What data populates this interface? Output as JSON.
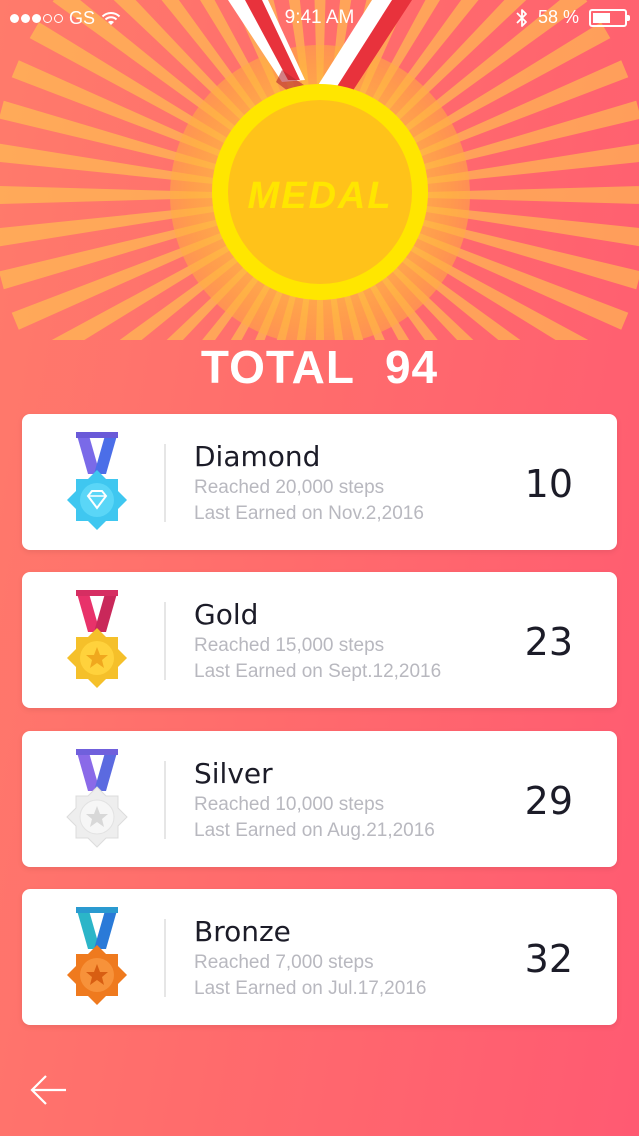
{
  "status_bar": {
    "carrier": "GS",
    "time": "9:41 AM",
    "battery_text": "58 %",
    "battery_level": 0.58,
    "signal_bars": 3,
    "icons": [
      "wifi-icon",
      "bluetooth-icon",
      "battery-icon"
    ]
  },
  "hero": {
    "medal_text": "MEDAL",
    "total_label": "TOTAL",
    "total_value": "94"
  },
  "medals": [
    {
      "name": "Diamond",
      "steps": "Reached 20,000 steps",
      "last": "Last Earned on Nov.2,2016",
      "count": "10",
      "icon": "diamond-medal-icon"
    },
    {
      "name": "Gold",
      "steps": "Reached 15,000 steps",
      "last": "Last Earned on Sept.12,2016",
      "count": "23",
      "icon": "gold-star-medal-icon"
    },
    {
      "name": "Silver",
      "steps": "Reached 10,000 steps",
      "last": "Last Earned on Aug.21,2016",
      "count": "29",
      "icon": "silver-star-medal-icon"
    },
    {
      "name": "Bronze",
      "steps": "Reached 7,000 steps",
      "last": "Last Earned on Jul.17,2016",
      "count": "32",
      "icon": "bronze-star-medal-icon"
    }
  ],
  "colors": {
    "background_start": "#ff7b6b",
    "background_end": "#ff5a72",
    "medal_gold": "#ffc21a",
    "ribbon_red": "#e8323c"
  },
  "nav": {
    "back_icon": "back-arrow-icon"
  }
}
